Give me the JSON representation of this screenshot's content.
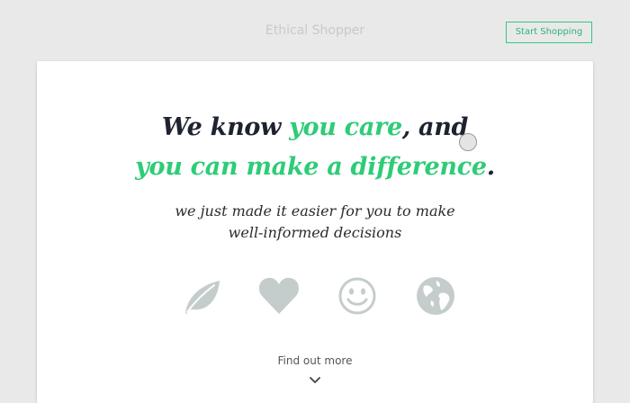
{
  "header": {
    "brand": "Ethical Shopper",
    "start_button": "Start Shopping"
  },
  "hero": {
    "line1_pre": "We know ",
    "line1_accent": "you care",
    "line1_post": ", and",
    "line2_accent": "you can make a difference",
    "line2_post": ".",
    "sub_line1": "we just made it easier for you to make",
    "sub_line2": "well-informed decisions"
  },
  "icons": [
    "leaf-icon",
    "heart-icon",
    "smiley-icon",
    "globe-icon"
  ],
  "footer": {
    "find_more": "Find out more"
  },
  "colors": {
    "accent": "#2ecc77",
    "text": "#1f2330",
    "icon_gray": "#c5cccc",
    "background": "#e9e9e9"
  }
}
